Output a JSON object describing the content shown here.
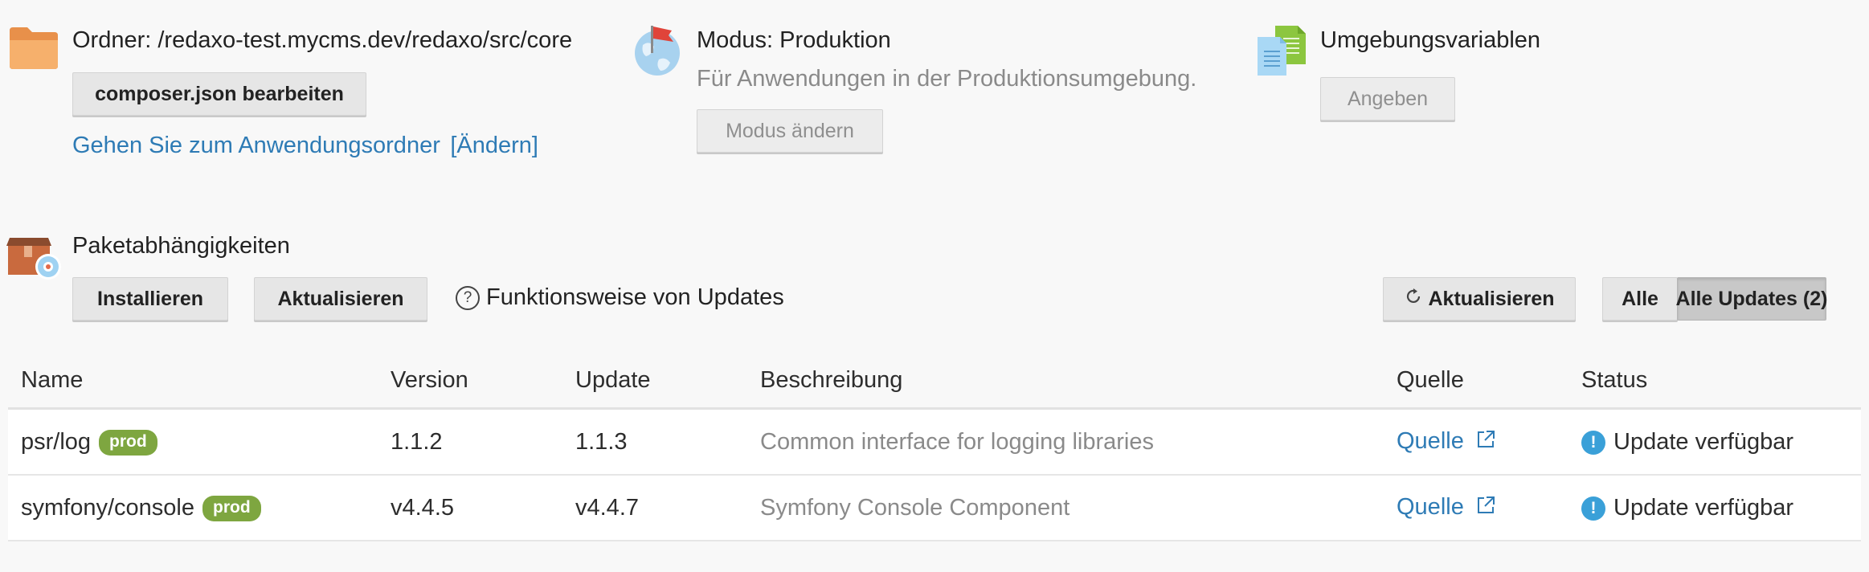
{
  "folder": {
    "title": "Ordner: /redaxo-test.mycms.dev/redaxo/src/core",
    "edit_button": "composer.json bearbeiten",
    "goto_link": "Gehen Sie zum Anwendungsordner",
    "change_link": "[Ändern]"
  },
  "mode": {
    "title": "Modus: Produktion",
    "description": "Für Anwendungen in der Produktionsumgebung.",
    "change_button": "Modus ändern"
  },
  "env": {
    "title": "Umgebungsvariablen",
    "set_button": "Angeben"
  },
  "packages": {
    "title": "Paketabhängigkeiten",
    "install_button": "Installieren",
    "update_button": "Aktualisieren",
    "help_text": "Funktionsweise von Updates",
    "refresh_button": "Aktualisieren",
    "filter_all": "Alle",
    "filter_updates": "Alle Updates (2)"
  },
  "table": {
    "headers": [
      "Name",
      "Version",
      "Update",
      "Beschreibung",
      "Quelle",
      "Status"
    ],
    "rows": [
      {
        "name": "psr/log",
        "badge": "prod",
        "version": "1.1.2",
        "update": "1.1.3",
        "description": "Common interface for logging libraries",
        "source": "Quelle",
        "status": "Update verfügbar"
      },
      {
        "name": "symfony/console",
        "badge": "prod",
        "version": "v4.4.5",
        "update": "v4.4.7",
        "description": "Symfony Console Component",
        "source": "Quelle",
        "status": "Update verfügbar"
      }
    ]
  },
  "colors": {
    "link": "#2e7bb5",
    "badge_prod": "#7ea640",
    "status_icon": "#3aa0d8",
    "folder_icon": "#f3a65c"
  }
}
